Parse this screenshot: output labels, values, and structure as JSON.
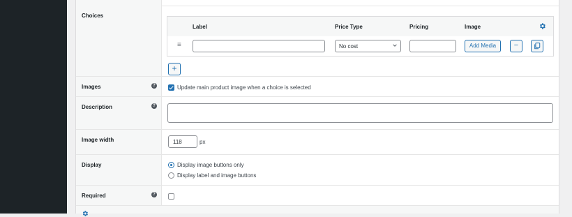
{
  "choices": {
    "label": "Choices",
    "columns": {
      "label": "Label",
      "price_type": "Price Type",
      "pricing": "Pricing",
      "image": "Image"
    },
    "row": {
      "label_value": "",
      "price_type_value": "No cost",
      "pricing_value": "",
      "add_media_label": "Add Media",
      "remove_symbol": "−"
    },
    "add_symbol": "+"
  },
  "images": {
    "label": "Images",
    "checkbox_label": "Update main product image when a choice is selected",
    "checked": true
  },
  "description": {
    "label": "Description",
    "value": ""
  },
  "image_width": {
    "label": "Image width",
    "value": "118",
    "unit": "px"
  },
  "display": {
    "label": "Display",
    "options": [
      {
        "label": "Display image buttons only",
        "selected": true
      },
      {
        "label": "Display label and image buttons",
        "selected": false
      }
    ]
  },
  "required": {
    "label": "Required",
    "checked": false
  },
  "help_glyph": "?",
  "colors": {
    "accent": "#2271b1",
    "sidebar": "#1d2327",
    "background": "#f0f0f1"
  }
}
